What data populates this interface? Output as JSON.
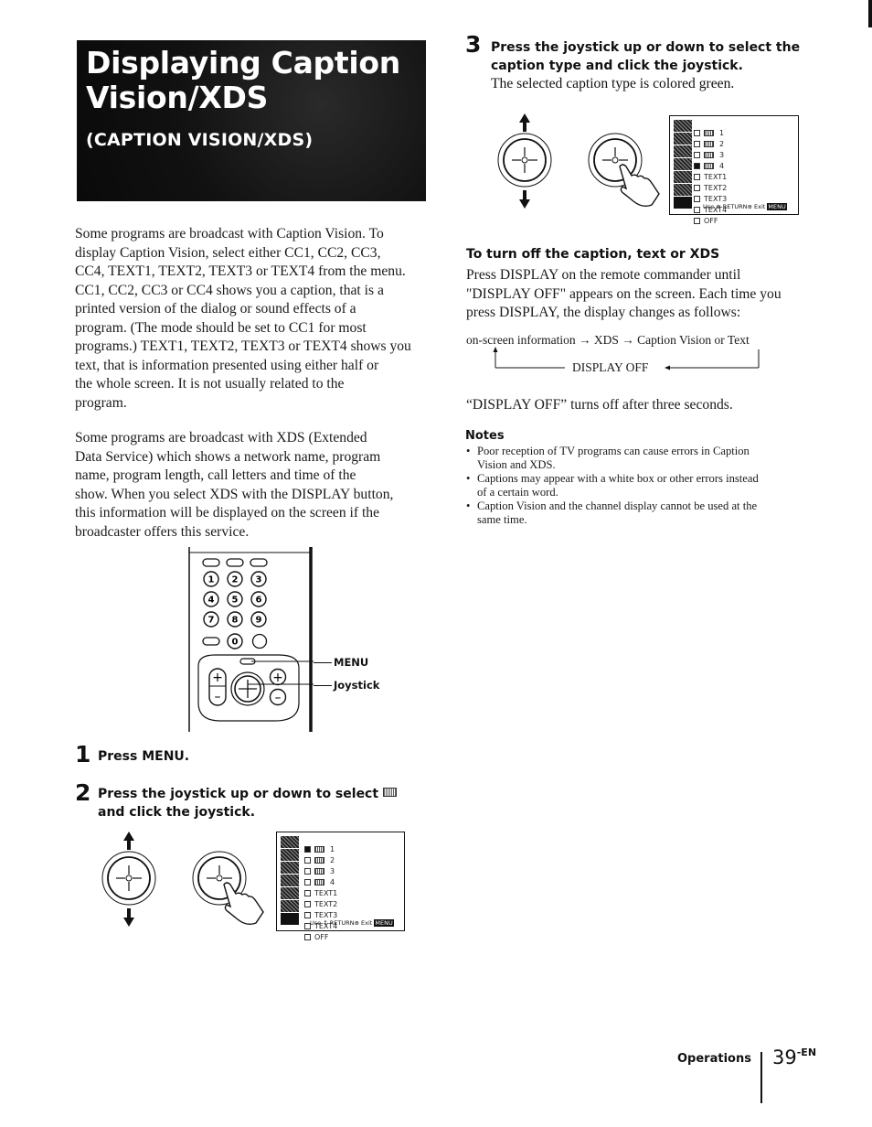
{
  "header": {
    "title_line1": "Displaying Caption",
    "title_line2": "Vision/XDS",
    "subtitle": "(CAPTION VISION/XDS)"
  },
  "intro": {
    "paragraph1_lines": [
      "Some programs are broadcast with Caption Vision.  To",
      "display Caption Vision, select either CC1, CC2, CC3,",
      "CC4, TEXT1, TEXT2, TEXT3 or TEXT4 from the menu.",
      "CC1, CC2, CC3 or CC4 shows you a caption, that is a",
      "printed version of the dialog or sound effects of a",
      "program. (The mode should be set to CC1 for most",
      "programs.) TEXT1, TEXT2, TEXT3 or TEXT4 shows you",
      "text, that is information presented using either half or",
      "the whole screen.  It is not usually related to the",
      "program."
    ],
    "paragraph2_lines": [
      "Some programs are broadcast with XDS (Extended",
      "Data Service) which shows a network name, program",
      "name, program length, call letters and time of the",
      "show.  When you select XDS with the DISPLAY button,",
      "this information will be displayed on the screen if the",
      "broadcaster offers this service."
    ]
  },
  "remote": {
    "keys": [
      "1",
      "2",
      "3",
      "4",
      "5",
      "6",
      "7",
      "8",
      "9",
      "0"
    ],
    "labels": {
      "menu": "MENU",
      "joystick": "Joystick"
    }
  },
  "steps": [
    {
      "number": "1",
      "lines": [
        "Press MENU."
      ]
    },
    {
      "number": "2",
      "lines": [
        "Press the joystick up or down to select",
        "and click the joystick."
      ],
      "inline_icon": "cc-icon"
    },
    {
      "number": "3",
      "lines": [
        "Press the joystick up or down to select the",
        "caption type and click the joystick."
      ],
      "detail": "The selected caption type is colored green."
    }
  ],
  "menu_screen": {
    "side_icons": [
      "VIDEO",
      "AUDIO",
      "CHANNEL",
      "TIMER",
      "SET UP",
      "CC"
    ],
    "options": [
      "1",
      "2",
      "3",
      "4",
      "TEXT1",
      "TEXT2",
      "TEXT3",
      "TEXT4",
      "OFF"
    ],
    "help": {
      "use": "Use",
      "return": "RETURN",
      "exit": "Exit",
      "menu": "MENU"
    },
    "step2_selected_index": 0,
    "step3_selected_index": 3
  },
  "turn_off": {
    "heading": "To turn off the caption, text or XDS",
    "lines": [
      "Press DISPLAY on the remote commander until",
      "\"DISPLAY OFF\" appears on the screen. Each time you",
      "press DISPLAY, the display changes as follows:"
    ],
    "flow": {
      "item1": "on-screen information",
      "item2": "XDS",
      "item3": "Caption Vision or Text",
      "return_label": "DISPLAY OFF"
    },
    "after": "“DISPLAY OFF” turns off after three seconds."
  },
  "notes": {
    "heading": "Notes",
    "items": [
      [
        "Poor reception of TV programs can cause errors in Caption",
        "Vision and XDS."
      ],
      [
        "Captions may appear with a white box or other errors instead",
        "of a certain word."
      ],
      [
        "Caption Vision and the channel display cannot be used at the",
        "same time."
      ]
    ]
  },
  "footer": {
    "section": "Operations",
    "page": "39",
    "page_suffix": "-EN"
  }
}
